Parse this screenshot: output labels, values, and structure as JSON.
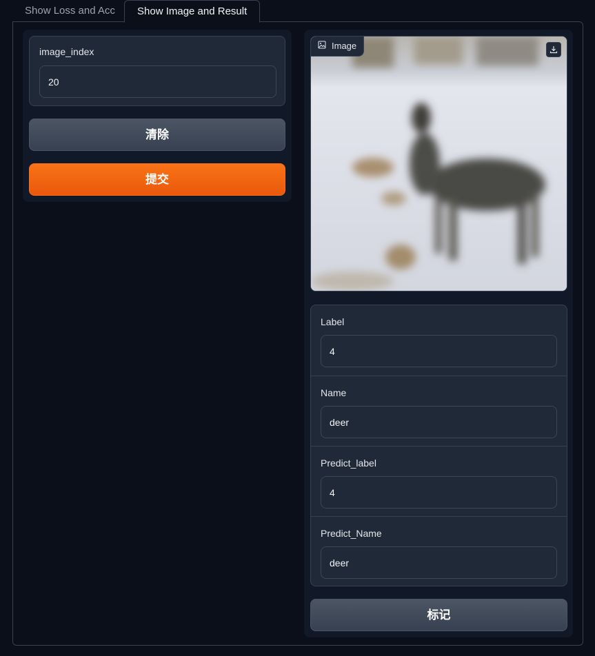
{
  "tabs": [
    {
      "label": "Show Loss and Acc",
      "active": false
    },
    {
      "label": "Show Image and Result",
      "active": true
    }
  ],
  "left": {
    "image_index": {
      "label": "image_index",
      "value": "20"
    },
    "clear_button": "清除",
    "submit_button": "提交"
  },
  "right": {
    "image": {
      "badge_label": "Image",
      "badge_icon": "image-icon",
      "download_icon": "download-icon"
    },
    "results": [
      {
        "label": "Label",
        "value": "4"
      },
      {
        "label": "Name",
        "value": "deer"
      },
      {
        "label": "Predict_label",
        "value": "4"
      },
      {
        "label": "Predict_Name",
        "value": "deer"
      }
    ],
    "flag_button": "标记"
  },
  "colors": {
    "background": "#0b0f19",
    "panel": "#111827",
    "input": "#1f2937",
    "border": "#374151",
    "primary": "#f97316",
    "secondary": "#4b5563"
  }
}
